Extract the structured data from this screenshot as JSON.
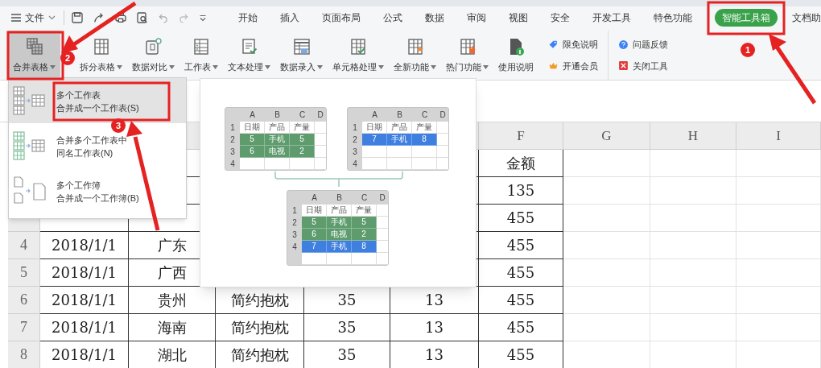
{
  "menu_bar": {
    "file_menu": "文件",
    "tabs": [
      {
        "label": "开始",
        "selected": false
      },
      {
        "label": "插入",
        "selected": false
      },
      {
        "label": "页面布局",
        "selected": false
      },
      {
        "label": "公式",
        "selected": false
      },
      {
        "label": "数据",
        "selected": false
      },
      {
        "label": "审阅",
        "selected": false
      },
      {
        "label": "视图",
        "selected": false
      },
      {
        "label": "安全",
        "selected": false
      },
      {
        "label": "开发工具",
        "selected": false
      },
      {
        "label": "特色功能",
        "selected": false
      },
      {
        "label": "智能工具箱",
        "selected": true
      },
      {
        "label": "文档助",
        "selected": false
      }
    ]
  },
  "toolbar": {
    "buttons": [
      {
        "label": "合并表格",
        "dropdown": true,
        "selected": true
      },
      {
        "label": "拆分表格",
        "dropdown": true,
        "selected": false
      },
      {
        "label": "数据对比",
        "dropdown": true,
        "selected": false
      },
      {
        "label": "工作表",
        "dropdown": true,
        "selected": false
      },
      {
        "label": "文本处理",
        "dropdown": true,
        "selected": false
      },
      {
        "label": "数据录入",
        "dropdown": true,
        "selected": false
      },
      {
        "label": "单元格处理",
        "dropdown": true,
        "selected": false
      },
      {
        "label": "全新功能",
        "dropdown": true,
        "selected": false
      },
      {
        "label": "热门功能",
        "dropdown": true,
        "selected": false
      },
      {
        "label": "使用说明",
        "dropdown": false,
        "selected": false
      }
    ],
    "links": [
      "限免说明",
      "开通会员",
      "问题反馈",
      "关闭工具"
    ]
  },
  "merge_menu": {
    "items": [
      {
        "lines": [
          "多个工作表",
          "合并成一个工作表(S)"
        ],
        "selected": true
      },
      {
        "lines": [
          "合并多个工作表中",
          "同名工作表(N)"
        ],
        "selected": false
      },
      {
        "lines": [
          "多个工作簿",
          "合并成一个工作簿(B)"
        ],
        "selected": false
      }
    ]
  },
  "preview": {
    "sheets": [
      {
        "columns": [
          "A",
          "B",
          "C",
          "D"
        ],
        "rows": [
          {
            "number": "1",
            "cells": [
              "日期",
              "产品",
              "产量"
            ]
          },
          {
            "number": "2",
            "cells": [
              "5",
              "手机",
              "5"
            ],
            "color": "#5e9c6e"
          },
          {
            "number": "3",
            "cells": [
              "6",
              "电视",
              "2"
            ],
            "color": "#5e9c6e"
          },
          {
            "number": "4"
          }
        ]
      },
      {
        "columns": [
          "A",
          "B",
          "C",
          "D"
        ],
        "rows": [
          {
            "number": "1",
            "cells": [
              "日期",
              "产品",
              "产量"
            ]
          },
          {
            "number": "2",
            "cells": [
              "7",
              "手机",
              "8"
            ],
            "color": "#3f7fe0"
          },
          {
            "number": "3"
          },
          {
            "number": "4"
          }
        ]
      },
      {
        "columns": [
          "A",
          "B",
          "C",
          "D"
        ],
        "rows": [
          {
            "number": "1",
            "cells": [
              "日期",
              "产品",
              "产量"
            ]
          },
          {
            "number": "2",
            "cells": [
              "5",
              "手机",
              "5"
            ],
            "color": "#5e9c6e"
          },
          {
            "number": "3",
            "cells": [
              "6",
              "电视",
              "2"
            ],
            "color": "#5e9c6e"
          },
          {
            "number": "4",
            "cells": [
              "7",
              "手机",
              "8"
            ],
            "color": "#3f7fe0"
          },
          {
            "cells": []
          }
        ]
      }
    ]
  },
  "spreadsheet": {
    "header_row": {
      "F": "F",
      "G": "G",
      "H": "H",
      "I": "I"
    },
    "rows": [
      {
        "cells": {
          "F": "金额"
        }
      },
      {
        "cells": {
          "F": "135"
        }
      },
      {
        "cells": {
          "F": "455"
        }
      },
      {
        "number": "4",
        "cells": {
          "A": "2018/1/1",
          "B": "广东",
          "F": "455"
        }
      },
      {
        "number": "5",
        "cells": {
          "A": "2018/1/1",
          "B": "广西",
          "F": "455"
        }
      },
      {
        "number": "6",
        "cells": {
          "A": "2018/1/1",
          "B": "贵州",
          "C": "简约抱枕",
          "D": "35",
          "E": "13",
          "F": "455"
        }
      },
      {
        "number": "7",
        "cells": {
          "A": "2018/1/1",
          "B": "海南",
          "C": "简约抱枕",
          "D": "35",
          "E": "13",
          "F": "455"
        }
      },
      {
        "number": "8",
        "cells": {
          "A": "2018/1/1",
          "B": "湖北",
          "C": "简约抱枕",
          "D": "35",
          "E": "13",
          "F": "455"
        }
      }
    ]
  },
  "annotations": {
    "badges": [
      "1",
      "2",
      "3"
    ]
  }
}
